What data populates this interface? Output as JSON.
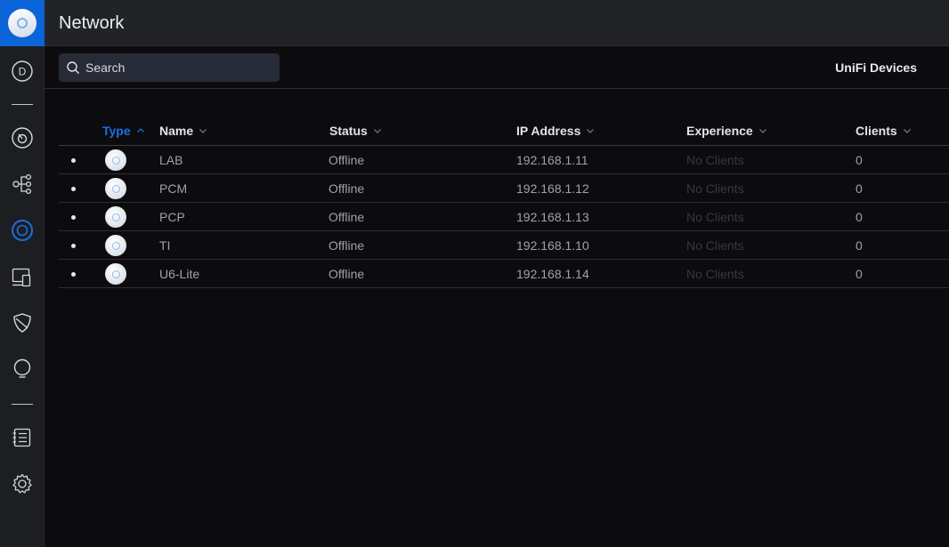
{
  "app": {
    "title": "Network"
  },
  "colors": {
    "accent": "#0b65d8",
    "sidebar_bg": "#1d1e21",
    "content_bg": "#0c0c0e",
    "active_sort": "#1c6fe0"
  },
  "sidebar": {
    "items": [
      {
        "name": "dashboard",
        "icon": "d-circle-icon"
      },
      {
        "name": "statistics",
        "icon": "gauge-icon"
      },
      {
        "name": "topology",
        "icon": "topology-icon"
      },
      {
        "name": "devices",
        "icon": "unifi-device-icon",
        "active": true
      },
      {
        "name": "clients",
        "icon": "clients-icon"
      },
      {
        "name": "insights",
        "icon": "shield-icon"
      },
      {
        "name": "alerts",
        "icon": "lightbulb-icon"
      },
      {
        "name": "system-log",
        "icon": "log-icon"
      },
      {
        "name": "settings",
        "icon": "gear-icon"
      }
    ]
  },
  "search": {
    "placeholder": "Search",
    "value": ""
  },
  "section_label": "UniFi Devices",
  "table": {
    "columns": [
      {
        "key": "type",
        "label": "Type",
        "sort": "asc",
        "active": true
      },
      {
        "key": "name",
        "label": "Name",
        "sort": "desc"
      },
      {
        "key": "status",
        "label": "Status",
        "sort": "desc"
      },
      {
        "key": "ip",
        "label": "IP Address",
        "sort": "desc"
      },
      {
        "key": "experience",
        "label": "Experience",
        "sort": "desc"
      },
      {
        "key": "clients",
        "label": "Clients",
        "sort": "desc"
      }
    ],
    "rows": [
      {
        "name": "LAB",
        "status": "Offline",
        "ip": "192.168.1.11",
        "experience": "No Clients",
        "clients": "0"
      },
      {
        "name": "PCM",
        "status": "Offline",
        "ip": "192.168.1.12",
        "experience": "No Clients",
        "clients": "0"
      },
      {
        "name": "PCP",
        "status": "Offline",
        "ip": "192.168.1.13",
        "experience": "No Clients",
        "clients": "0"
      },
      {
        "name": "TI",
        "status": "Offline",
        "ip": "192.168.1.10",
        "experience": "No Clients",
        "clients": "0"
      },
      {
        "name": "U6-Lite",
        "status": "Offline",
        "ip": "192.168.1.14",
        "experience": "No Clients",
        "clients": "0"
      }
    ]
  }
}
